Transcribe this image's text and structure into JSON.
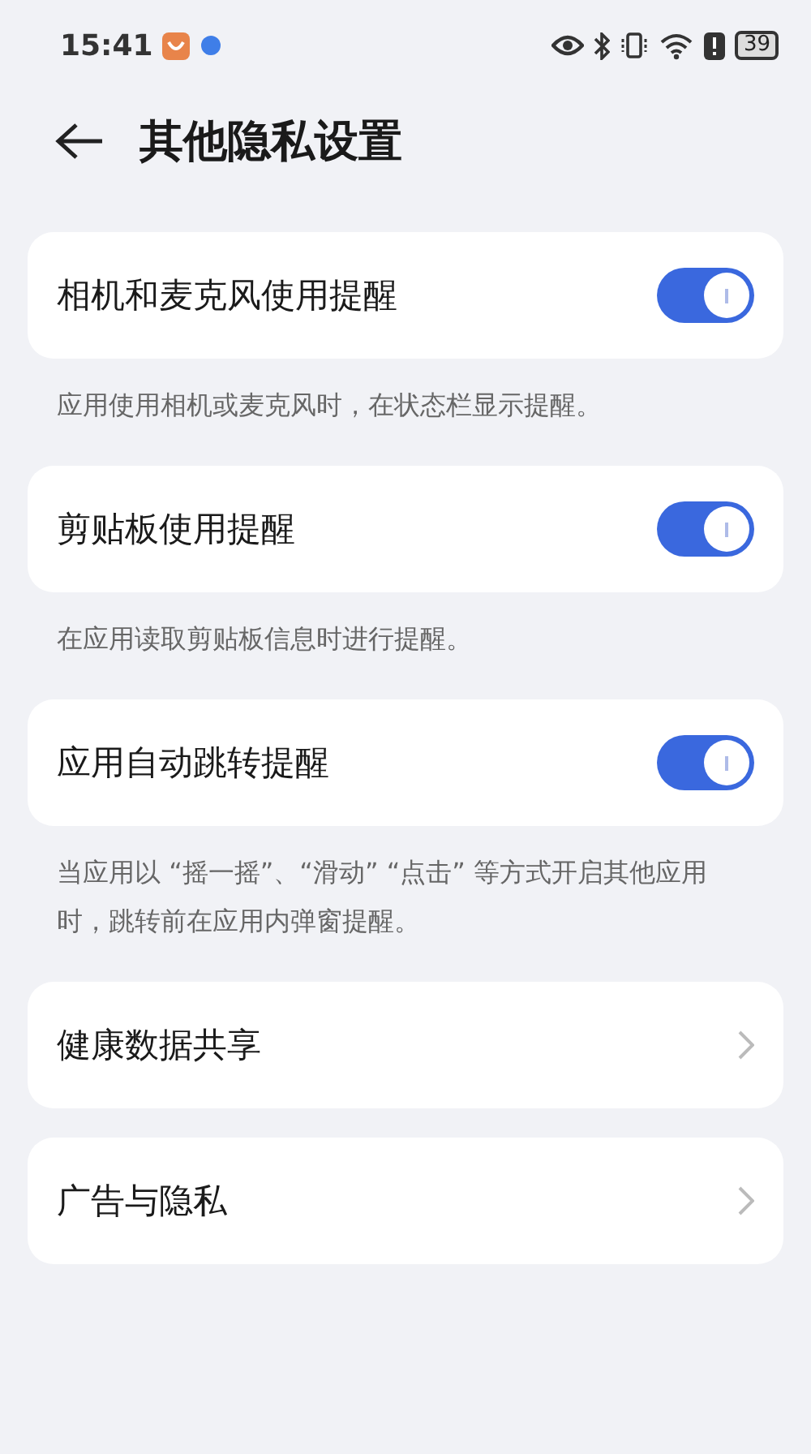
{
  "status_bar": {
    "time": "15:41",
    "battery": "39"
  },
  "header": {
    "title": "其他隐私设置"
  },
  "items": [
    {
      "kind": "toggle",
      "label": "相机和麦克风使用提醒",
      "on": true,
      "note": "应用使用相机或麦克风时，在状态栏显示提醒。"
    },
    {
      "kind": "toggle",
      "label": "剪贴板使用提醒",
      "on": true,
      "note": "在应用读取剪贴板信息时进行提醒。"
    },
    {
      "kind": "toggle",
      "label": "应用自动跳转提醒",
      "on": true,
      "note": "当应用以 “摇一摇”、“滑动” “点击” 等方式开启其他应用时，跳转前在应用内弹窗提醒。"
    },
    {
      "kind": "link",
      "label": "健康数据共享"
    },
    {
      "kind": "link",
      "label": "广告与隐私"
    }
  ]
}
